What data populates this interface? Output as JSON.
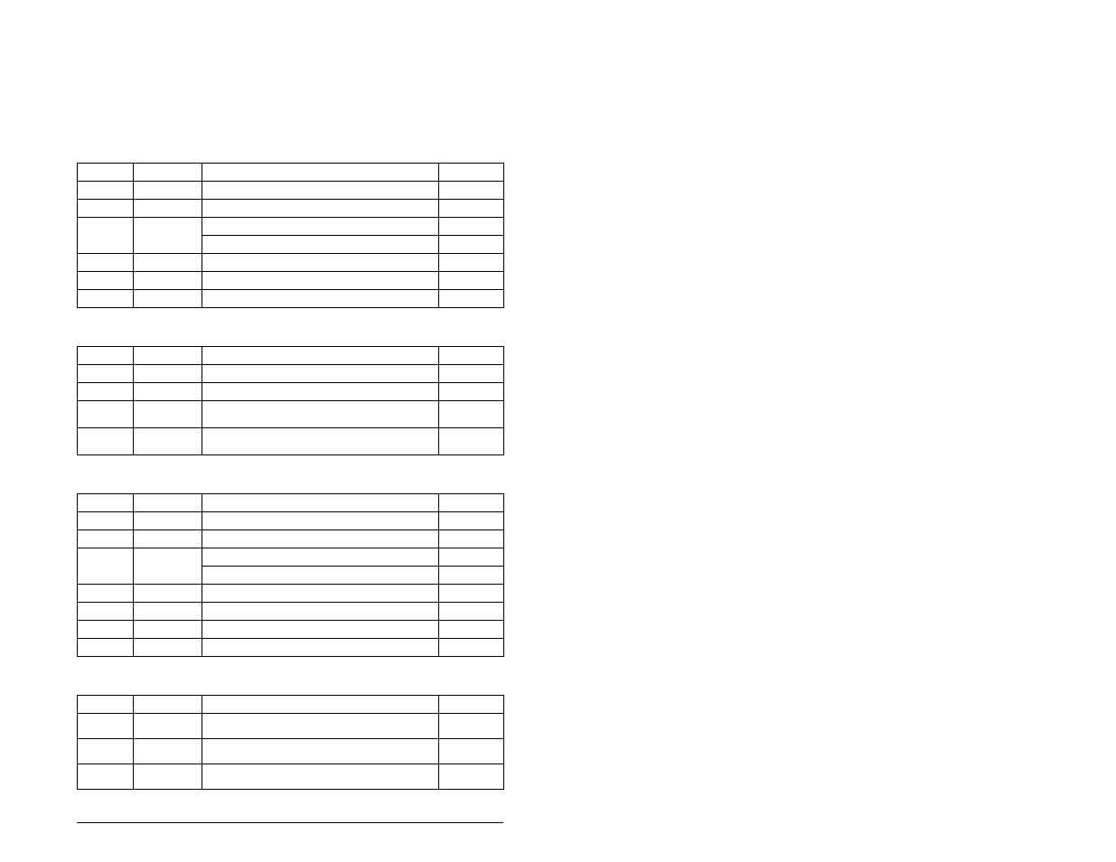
{
  "tables": [
    {
      "id": "table-1",
      "rows": [
        {
          "a": "",
          "b": "",
          "c": "",
          "d": ""
        },
        {
          "a": "",
          "b": "",
          "c": "",
          "d": ""
        },
        {
          "a": "",
          "b": "",
          "c": "",
          "d": ""
        },
        {
          "a": "",
          "b": "",
          "c": "",
          "d": "",
          "mergeAB": true
        },
        {
          "a": "",
          "b": "",
          "c": "",
          "d": "",
          "hiddenAB": true
        },
        {
          "a": "",
          "b": "",
          "c": "",
          "d": ""
        },
        {
          "a": "",
          "b": "",
          "c": "",
          "d": ""
        },
        {
          "a": "",
          "b": "",
          "c": "",
          "d": ""
        }
      ]
    },
    {
      "id": "table-2",
      "rows": [
        {
          "a": "",
          "b": "",
          "c": "",
          "d": ""
        },
        {
          "a": "",
          "b": "",
          "c": "",
          "d": ""
        },
        {
          "a": "",
          "b": "",
          "c": "",
          "d": ""
        },
        {
          "a": "",
          "b": "",
          "c": "",
          "d": "",
          "tall": true
        },
        {
          "a": "",
          "b": "",
          "c": "",
          "d": "",
          "tall": true
        }
      ]
    },
    {
      "id": "table-3",
      "rows": [
        {
          "a": "",
          "b": "",
          "c": "",
          "d": ""
        },
        {
          "a": "",
          "b": "",
          "c": "",
          "d": ""
        },
        {
          "a": "",
          "b": "",
          "c": "",
          "d": ""
        },
        {
          "a": "",
          "b": "",
          "c": "",
          "d": "",
          "mergeAB": true
        },
        {
          "a": "",
          "b": "",
          "c": "",
          "d": "",
          "hiddenAB": true
        },
        {
          "a": "",
          "b": "",
          "c": "",
          "d": ""
        },
        {
          "a": "",
          "b": "",
          "c": "",
          "d": ""
        },
        {
          "a": "",
          "b": "",
          "c": "",
          "d": ""
        },
        {
          "a": "",
          "b": "",
          "c": "",
          "d": ""
        }
      ]
    },
    {
      "id": "table-4",
      "rows": [
        {
          "a": "",
          "b": "",
          "c": "",
          "d": ""
        },
        {
          "a": "",
          "b": "",
          "c": "",
          "d": "",
          "tall": true
        },
        {
          "a": "",
          "b": "",
          "c": "",
          "d": "",
          "tall": true
        },
        {
          "a": "",
          "b": "",
          "c": "",
          "d": "",
          "tall": true
        }
      ]
    }
  ]
}
